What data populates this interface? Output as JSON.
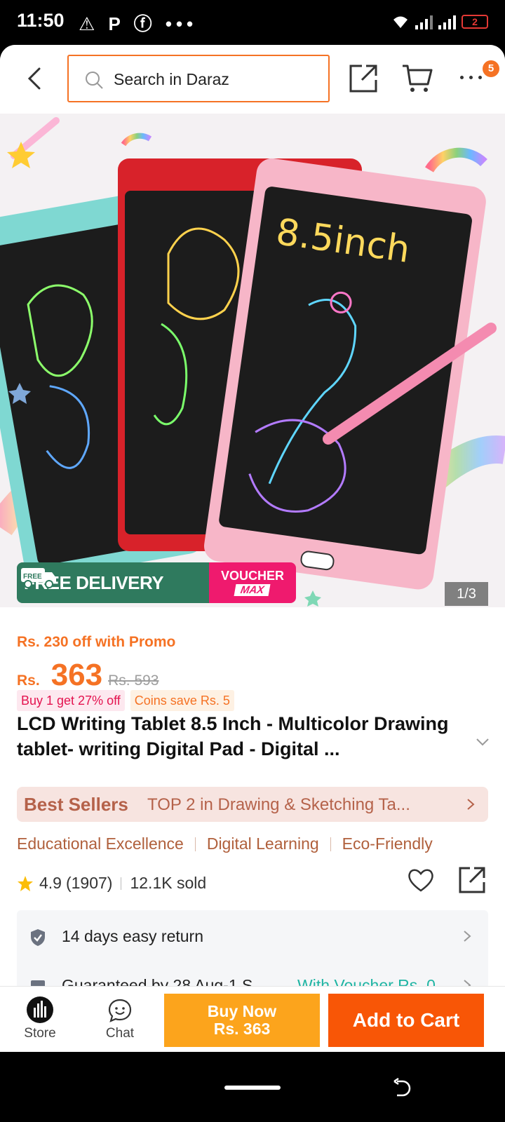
{
  "status_bar": {
    "time": "11:50",
    "left_icons": "⚠ P ⓕ •••",
    "battery": "2"
  },
  "header": {
    "search_placeholder": "Search in Daraz",
    "cart_badge": "5",
    "icons": [
      "back-arrow-icon",
      "search-icon",
      "share-icon",
      "cart-icon",
      "more-icon"
    ]
  },
  "hero": {
    "tablet_text": "8.5inch",
    "delivery_label": "FREE DELIVERY",
    "free_tag": "FREE",
    "voucher_line1": "VOUCHER",
    "voucher_line2": "MAX",
    "image_counter": "1/3"
  },
  "price": {
    "promo": "Rs. 230 off with Promo",
    "currency": "Rs.",
    "current": "363",
    "original": "Rs. 593",
    "tags": [
      "Buy 1 get 27% off",
      "Coins save Rs. 5"
    ]
  },
  "product": {
    "title": "LCD Writing Tablet 8.5 Inch - Multicolor Drawing tablet- writing Digital Pad - Digital ...",
    "bestseller_logo": "Best Sellers",
    "bestseller_text": "TOP 2 in Drawing & Sketching Ta...",
    "features": [
      "Educational Excellence",
      "Digital Learning",
      "Eco-Friendly"
    ],
    "rating": "4.9",
    "reviews": "(1907)",
    "sold": "12.1K sold"
  },
  "services": [
    {
      "text": "14 days easy return",
      "extra": ""
    },
    {
      "text": "Guaranteed by 28 Aug-1 S...",
      "extra": "With Voucher Rs. 0"
    }
  ],
  "bottom_bar": {
    "store_label": "Store",
    "chat_label": "Chat",
    "buy_now_line1": "Buy Now",
    "buy_now_line2": "Rs. 363",
    "add_to_cart": "Add to Cart"
  },
  "colors": {
    "accent": "#f57224",
    "buy_now": "#fca41c",
    "add_to_cart": "#f85606",
    "delivery_green": "#2f7a5e",
    "voucher_pink": "#ef1a6e"
  }
}
